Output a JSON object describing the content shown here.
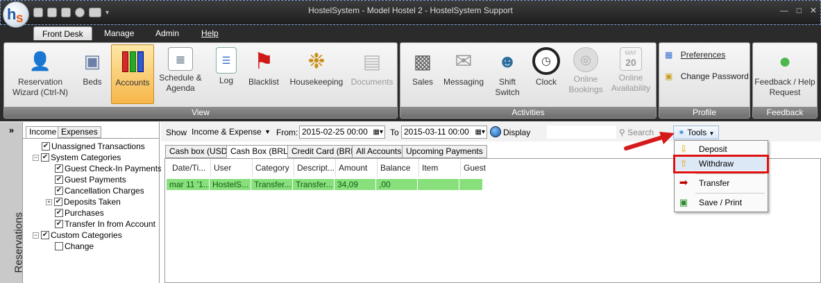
{
  "window": {
    "title": "HostelSystem - Model Hostel 2 - HostelSystem Support",
    "logo_h": "h",
    "logo_s": "s"
  },
  "menu_tabs": [
    {
      "label": "Front Desk"
    },
    {
      "label": "Manage"
    },
    {
      "label": "Admin"
    },
    {
      "label": "Help"
    }
  ],
  "ribbon": {
    "view": {
      "caption": "View",
      "buttons": [
        {
          "label": "Reservation Wizard (Ctrl-N)",
          "icon": "person-add-icon"
        },
        {
          "label": "Beds",
          "icon": "bed-icon"
        },
        {
          "label": "Accounts",
          "icon": "binders-icon",
          "selected": true
        },
        {
          "label": "Schedule & Agenda",
          "icon": "calendar-icon"
        },
        {
          "label": "Log",
          "icon": "notepad-icon"
        },
        {
          "label": "Blacklist",
          "icon": "red-flag-icon"
        },
        {
          "label": "Housekeeping",
          "icon": "broom-icon"
        },
        {
          "label": "Documents",
          "icon": "documents-icon",
          "disabled": true
        }
      ]
    },
    "activities": {
      "caption": "Activities",
      "buttons": [
        {
          "label": "Sales",
          "icon": "cash-register-icon"
        },
        {
          "label": "Messaging",
          "icon": "envelope-icon"
        },
        {
          "label": "Shift Switch",
          "icon": "users-icon"
        },
        {
          "label": "Clock",
          "icon": "clock-icon"
        },
        {
          "label": "Online Bookings",
          "icon": "globe-icon",
          "disabled": true
        },
        {
          "label": "Online Availability",
          "icon": "calendar-day-icon",
          "disabled": true,
          "day": "20",
          "month": "MAY"
        }
      ]
    },
    "profile": {
      "caption": "Profile",
      "preferences": "Preferences",
      "change_password": "Change Password"
    },
    "feedback": {
      "caption": "Feedback",
      "button": "Feedback / Help Request"
    }
  },
  "sidebar": {
    "vertical_label": "Reservations",
    "collapse_glyph": "»",
    "tabs": [
      "Income",
      "Expenses"
    ],
    "tree": [
      {
        "label": "Unassigned Transactions",
        "checked": true,
        "level": 1
      },
      {
        "label": "System Categories",
        "checked": true,
        "level": 0,
        "expander": "−"
      },
      {
        "label": "Guest Check-In Payments",
        "checked": true,
        "level": 2
      },
      {
        "label": "Guest Payments",
        "checked": true,
        "level": 2
      },
      {
        "label": "Cancellation Charges",
        "checked": true,
        "level": 2
      },
      {
        "label": "Deposits Taken",
        "checked": true,
        "level": 1,
        "expander": "+"
      },
      {
        "label": "Purchases",
        "checked": true,
        "level": 2
      },
      {
        "label": "Transfer In from Account",
        "checked": true,
        "level": 2
      },
      {
        "label": "Custom Categories",
        "checked": true,
        "level": 0,
        "expander": "−"
      },
      {
        "label": "Change",
        "checked": false,
        "level": 2
      }
    ]
  },
  "filter": {
    "show_label": "Show",
    "show_value": "Income & Expense",
    "from_label": "From:",
    "from_value": "2015-02-25 00:00",
    "to_label": "To",
    "to_value": "2015-03-11 00:00",
    "display_label": "Display",
    "search_placeholder": "Search",
    "tools_label": "Tools"
  },
  "account_tabs": [
    {
      "label": "Cash box (USD)"
    },
    {
      "label": "Cash Box (BRL)",
      "active": true
    },
    {
      "label": "Credit Card (BRL)"
    },
    {
      "label": "All Accounts"
    },
    {
      "label": "Upcoming Payments"
    }
  ],
  "grid": {
    "columns": [
      "Date/Ti...",
      "User",
      "Category",
      "Descript...",
      "Amount",
      "Balance",
      "Item",
      "Guest"
    ],
    "rows": [
      {
        "cells": [
          "mar 11 '1...",
          "HostelS...",
          "Transfer...",
          "Transfer...",
          "34,09",
          ",00",
          "",
          ""
        ],
        "color": "#88e07c"
      }
    ]
  },
  "tools_menu": [
    {
      "label": "Deposit",
      "icon": "deposit-icon"
    },
    {
      "label": "Withdraw",
      "icon": "withdraw-icon",
      "highlighted": true
    },
    {
      "label": "Transfer",
      "icon": "red-arrow-icon"
    },
    {
      "label": "Save / Print",
      "icon": "save-print-icon"
    }
  ]
}
